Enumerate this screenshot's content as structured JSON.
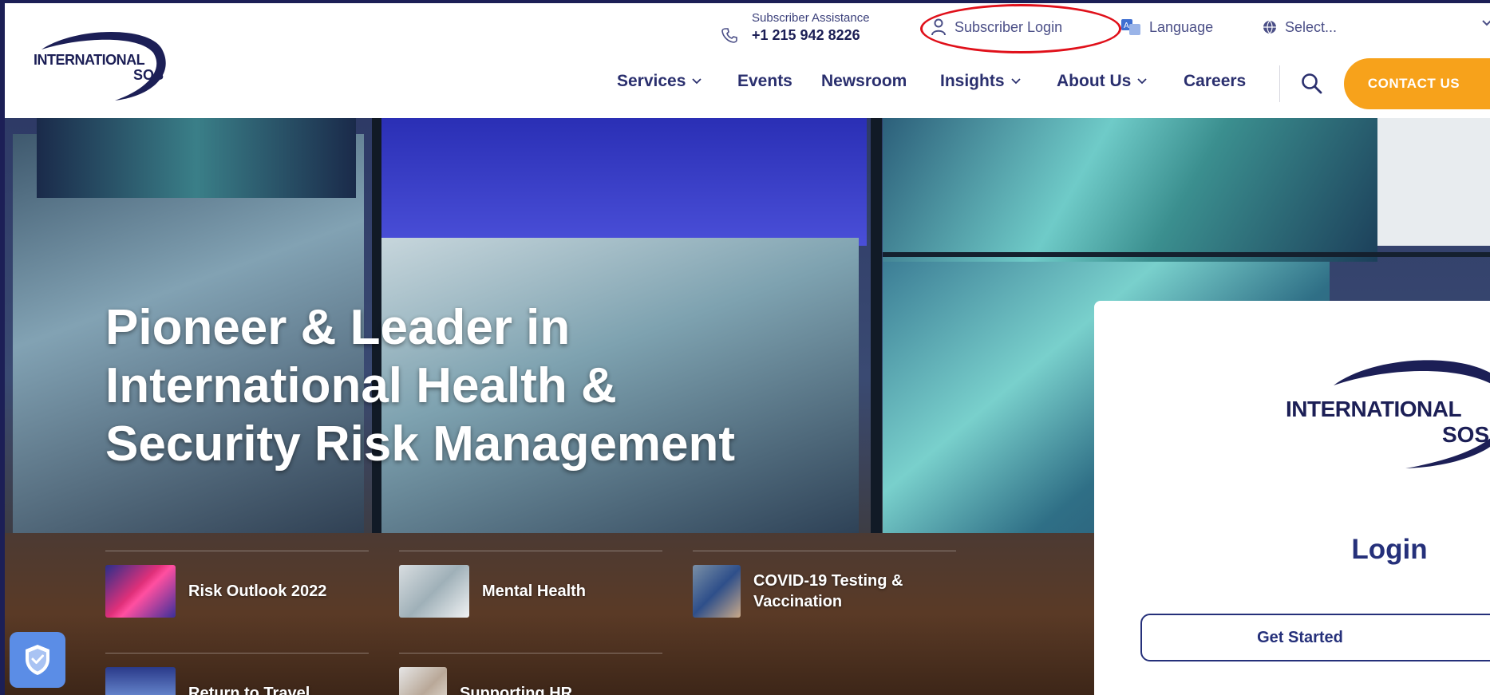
{
  "header": {
    "logo": {
      "line1": "INTERNATIONAL",
      "line2": "SOS"
    },
    "assistance": {
      "label": "Subscriber Assistance",
      "phone": "+1 215 942 8226"
    },
    "subscriber_login": "Subscriber Login",
    "language_label": "Language",
    "language_select": "Select...",
    "nav": [
      {
        "label": "Services",
        "dropdown": true
      },
      {
        "label": "Events",
        "dropdown": false
      },
      {
        "label": "Newsroom",
        "dropdown": false
      },
      {
        "label": "Insights",
        "dropdown": true
      },
      {
        "label": "About Us",
        "dropdown": true
      },
      {
        "label": "Careers",
        "dropdown": false
      }
    ],
    "contact_button": "CONTACT US"
  },
  "hero": {
    "title_lines": [
      "Pioneer & Leader in",
      "International Health &",
      "Security Risk Management"
    ],
    "quick_links": [
      {
        "label": "Risk Outlook 2022"
      },
      {
        "label": "Mental Health"
      },
      {
        "label_lines": [
          "COVID-19 Testing &",
          "Vaccination"
        ]
      },
      {
        "label": "Return to Travel"
      },
      {
        "label": "Supporting HR"
      }
    ]
  },
  "login_card": {
    "logo": {
      "line1": "INTERNATIONAL",
      "line2": "SOS"
    },
    "title": "Login",
    "button": "Get Started"
  },
  "colors": {
    "brand_navy": "#1c1f56",
    "accent_orange": "#f7a21b",
    "highlight_red": "#e0101a",
    "privacy_blue": "#5b8de6"
  },
  "icons": [
    "phone-icon",
    "user-icon",
    "translate-icon",
    "globe-icon",
    "chevron-down-icon",
    "search-icon",
    "shield-check-icon"
  ]
}
